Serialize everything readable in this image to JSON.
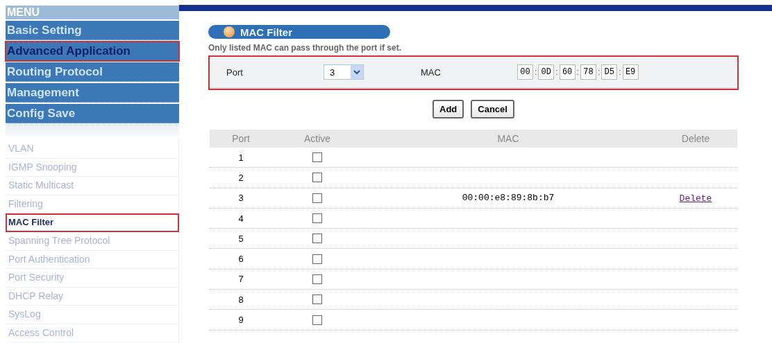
{
  "menu": {
    "title": "MENU",
    "items": [
      {
        "label": "Basic Setting",
        "selected": false,
        "highlighted": false
      },
      {
        "label": "Advanced Application",
        "selected": true,
        "highlighted": true
      },
      {
        "label": "Routing Protocol",
        "selected": false,
        "highlighted": false
      },
      {
        "label": "Management",
        "selected": false,
        "highlighted": false
      },
      {
        "label": "Config Save",
        "selected": false,
        "highlighted": false
      }
    ]
  },
  "submenu": {
    "items": [
      {
        "label": "VLAN",
        "selected": false,
        "highlighted": false
      },
      {
        "label": "IGMP Snooping",
        "selected": false,
        "highlighted": false
      },
      {
        "label": "Static Multicast",
        "selected": false,
        "highlighted": false
      },
      {
        "label": "Filtering",
        "selected": false,
        "highlighted": false
      },
      {
        "label": "MAC Filter",
        "selected": true,
        "highlighted": true
      },
      {
        "label": "Spanning Tree Protocol",
        "selected": false,
        "highlighted": false
      },
      {
        "label": "Port Authentication",
        "selected": false,
        "highlighted": false
      },
      {
        "label": "Port Security",
        "selected": false,
        "highlighted": false
      },
      {
        "label": "DHCP Relay",
        "selected": false,
        "highlighted": false
      },
      {
        "label": "SysLog",
        "selected": false,
        "highlighted": false
      },
      {
        "label": "Access Control",
        "selected": false,
        "highlighted": false
      }
    ]
  },
  "page": {
    "title": "MAC Filter",
    "description": "Only listed MAC can pass through the port if set."
  },
  "form": {
    "highlighted": true,
    "port_label": "Port",
    "port_value": "3",
    "mac_label": "MAC",
    "mac_octets": [
      "00",
      "0D",
      "60",
      "78",
      "D5",
      "E9"
    ],
    "separator": ":"
  },
  "buttons": [
    "Add",
    "Cancel"
  ],
  "table": {
    "columns": [
      "Port",
      "Active",
      "MAC",
      "Delete"
    ],
    "rows": [
      {
        "port": "1",
        "active": false
      },
      {
        "port": "2",
        "active": false
      },
      {
        "port": "3",
        "active": false,
        "mac": "00:00:e8:89:8b:b7",
        "delete": "Delete"
      },
      {
        "port": "4",
        "active": false
      },
      {
        "port": "5",
        "active": false
      },
      {
        "port": "6",
        "active": false
      },
      {
        "port": "7",
        "active": false
      },
      {
        "port": "8",
        "active": false
      },
      {
        "port": "9",
        "active": false
      }
    ]
  }
}
